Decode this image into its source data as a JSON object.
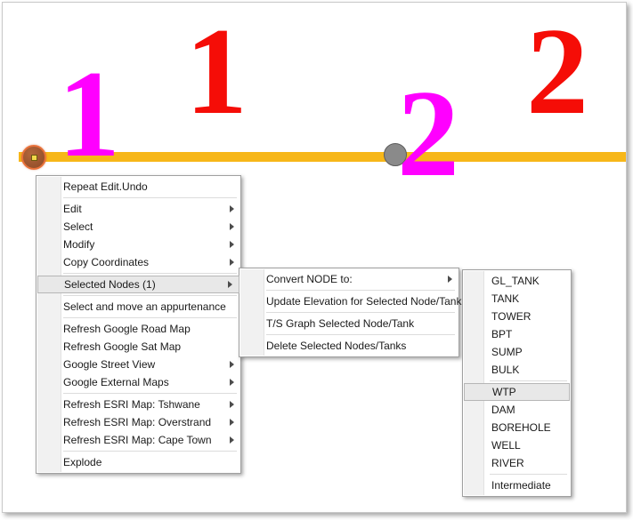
{
  "canvas": {
    "labels": [
      {
        "name": "node-label-1",
        "text": "1",
        "color": "#ff00ff"
      },
      {
        "name": "link-label-1",
        "text": "1",
        "color": "#f50d07"
      },
      {
        "name": "node-label-2",
        "text": "2",
        "color": "#ff00ff"
      },
      {
        "name": "link-label-2",
        "text": "2",
        "color": "#f50d07"
      }
    ],
    "pipe_color": "#f7b719",
    "selected_node_color": "#9d5630",
    "plain_node_color": "#8a8a8a"
  },
  "menu_main": {
    "items": [
      {
        "label": "Repeat Edit.Undo",
        "submenu": false
      },
      {
        "label": "Edit",
        "submenu": true
      },
      {
        "label": "Select",
        "submenu": true
      },
      {
        "label": "Modify",
        "submenu": true
      },
      {
        "label": "Copy Coordinates",
        "submenu": true
      },
      {
        "label": "Selected Nodes (1)",
        "submenu": true,
        "highlighted": true
      },
      {
        "label": "Select and move an appurtenance",
        "submenu": false
      },
      {
        "label": "Refresh Google Road Map",
        "submenu": false
      },
      {
        "label": "Refresh Google Sat Map",
        "submenu": false
      },
      {
        "label": "Google Street View",
        "submenu": true
      },
      {
        "label": "Google External Maps",
        "submenu": true
      },
      {
        "label": "Refresh ESRI Map: Tshwane",
        "submenu": true
      },
      {
        "label": "Refresh ESRI Map: Overstrand",
        "submenu": true
      },
      {
        "label": "Refresh ESRI Map: Cape Town",
        "submenu": true
      },
      {
        "label": "Explode",
        "submenu": false
      }
    ]
  },
  "menu_selected_nodes": {
    "items": [
      {
        "label": "Convert NODE to:",
        "submenu": true
      },
      {
        "label": "Update Elevation for Selected Node/Tank",
        "submenu": false
      },
      {
        "label": "T/S Graph Selected Node/Tank",
        "submenu": false
      },
      {
        "label": "Delete Selected Nodes/Tanks",
        "submenu": false
      }
    ]
  },
  "menu_convert_node": {
    "items": [
      {
        "label": "GL_TANK"
      },
      {
        "label": "TANK"
      },
      {
        "label": "TOWER"
      },
      {
        "label": "BPT"
      },
      {
        "label": "SUMP"
      },
      {
        "label": "BULK"
      },
      {
        "label": "WTP",
        "highlighted": true
      },
      {
        "label": "DAM"
      },
      {
        "label": "BOREHOLE"
      },
      {
        "label": "WELL"
      },
      {
        "label": "RIVER"
      },
      {
        "label": "Intermediate"
      }
    ]
  }
}
